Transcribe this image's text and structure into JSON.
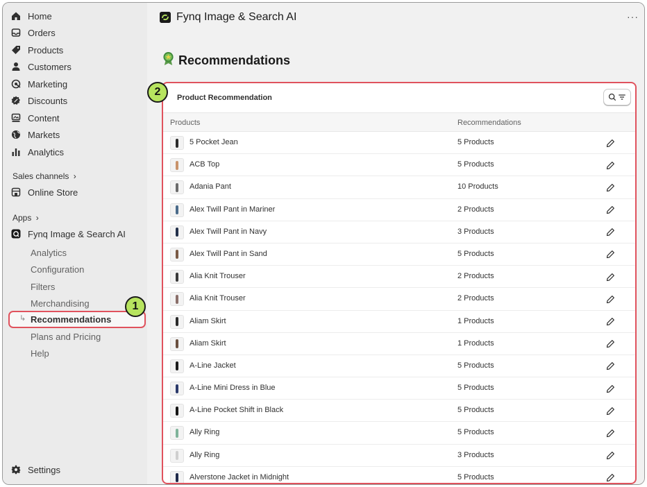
{
  "sidebar": {
    "nav": [
      {
        "label": "Home",
        "icon": "home-icon"
      },
      {
        "label": "Orders",
        "icon": "inbox-icon"
      },
      {
        "label": "Products",
        "icon": "tag-icon"
      },
      {
        "label": "Customers",
        "icon": "person-icon"
      },
      {
        "label": "Marketing",
        "icon": "target-icon"
      },
      {
        "label": "Discounts",
        "icon": "discount-icon"
      },
      {
        "label": "Content",
        "icon": "content-icon"
      },
      {
        "label": "Markets",
        "icon": "globe-icon"
      },
      {
        "label": "Analytics",
        "icon": "bar-chart-icon"
      }
    ],
    "sales_channels_label": "Sales channels",
    "online_store_label": "Online Store",
    "apps_label": "Apps",
    "app_name": "Fynq Image & Search AI",
    "app_sub_items": [
      "Analytics",
      "Configuration",
      "Filters",
      "Merchandising",
      "Recommendations",
      "Plans and Pricing",
      "Help"
    ],
    "active_sub_item": "Recommendations",
    "settings_label": "Settings"
  },
  "annotations": {
    "badge_1": "1",
    "badge_2": "2",
    "highlight_color": "#e0525d",
    "badge_color": "#b7e45f"
  },
  "header": {
    "app_title": "Fynq Image & Search AI",
    "more_label": "···"
  },
  "page": {
    "title": "Recommendations"
  },
  "card": {
    "title": "Product Recommendation",
    "columns": {
      "products": "Products",
      "recommendations": "Recommendations"
    },
    "rows": [
      {
        "name": "5 Pocket Jean",
        "count": "5 Products",
        "thumb_color": "#2b2b2b"
      },
      {
        "name": "ACB Top",
        "count": "5 Products",
        "thumb_color": "#c9936b"
      },
      {
        "name": "Adania Pant",
        "count": "10 Products",
        "thumb_color": "#6b6b6b"
      },
      {
        "name": "Alex Twill Pant in Mariner",
        "count": "2 Products",
        "thumb_color": "#4a6b8a"
      },
      {
        "name": "Alex Twill Pant in Navy",
        "count": "3 Products",
        "thumb_color": "#22304a"
      },
      {
        "name": "Alex Twill Pant in Sand",
        "count": "5 Products",
        "thumb_color": "#7a5a45"
      },
      {
        "name": "Alia Knit Trouser",
        "count": "2 Products",
        "thumb_color": "#3a3a3a"
      },
      {
        "name": "Alia Knit Trouser",
        "count": "2 Products",
        "thumb_color": "#8a6f6a"
      },
      {
        "name": "Aliam Skirt",
        "count": "1 Products",
        "thumb_color": "#2a2a2a"
      },
      {
        "name": "Aliam Skirt",
        "count": "1 Products",
        "thumb_color": "#6a5040"
      },
      {
        "name": "A-Line Jacket",
        "count": "5 Products",
        "thumb_color": "#1d1d1d"
      },
      {
        "name": "A-Line Mini Dress in Blue",
        "count": "5 Products",
        "thumb_color": "#2c3a6b"
      },
      {
        "name": "A-Line Pocket Shift in Black",
        "count": "5 Products",
        "thumb_color": "#151515"
      },
      {
        "name": "Ally Ring",
        "count": "5 Products",
        "thumb_color": "#7fb39a"
      },
      {
        "name": "Ally Ring",
        "count": "3 Products",
        "thumb_color": "#cfcfcf"
      },
      {
        "name": "Alverstone Jacket in Midnight",
        "count": "5 Products",
        "thumb_color": "#1f2a4a"
      }
    ]
  }
}
